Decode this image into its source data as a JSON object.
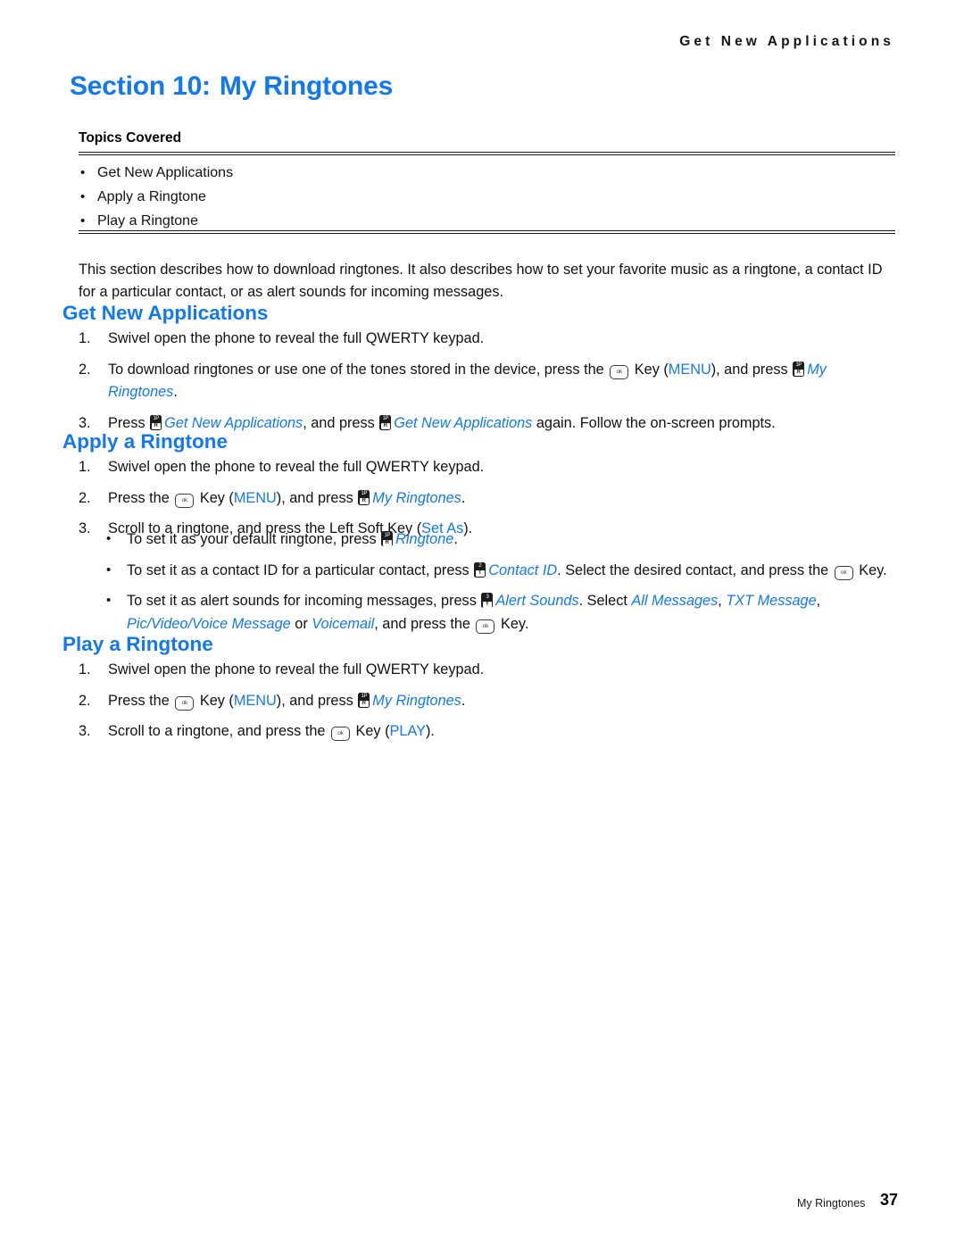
{
  "header": {
    "running_head": "Get New Applications"
  },
  "section": {
    "number_label": "Section 10:",
    "title": "My Ringtones"
  },
  "topics": {
    "label": "Topics Covered",
    "items": [
      "Get New Applications",
      "Apply a Ringtone",
      "Play a Ringtone"
    ]
  },
  "intro": "This section describes how to download ringtones. It also describes how to set your favorite music as a ringtone, a contact ID for a particular contact, or as alert sounds for incoming messages.",
  "get_new_applications": {
    "heading": "Get New Applications",
    "steps": [
      {
        "marker": "1.",
        "parts": [
          {
            "type": "text",
            "value": "Swivel open the phone to reveal the full QWERTY keypad."
          }
        ]
      },
      {
        "marker": "2.",
        "parts": [
          {
            "type": "text",
            "value": "To download ringtones or use one of the tones stored in the device, press the "
          },
          {
            "type": "ok-key",
            "value": "ok"
          },
          {
            "type": "text",
            "value": " Key ("
          },
          {
            "type": "blue",
            "value": "MENU"
          },
          {
            "type": "text",
            "value": "), and press "
          },
          {
            "type": "kb-key",
            "top": "1P",
            "bottom": "R"
          },
          {
            "type": "blue-it",
            "value": "My Ringtones"
          },
          {
            "type": "text",
            "value": "."
          }
        ]
      },
      {
        "marker": "3.",
        "parts": [
          {
            "type": "text",
            "value": "Press "
          },
          {
            "type": "kb-key",
            "top": "1P",
            "bottom": "R"
          },
          {
            "type": "blue-it",
            "value": "Get New Applications"
          },
          {
            "type": "text",
            "value": ", and press "
          },
          {
            "type": "kb-key",
            "top": "1P",
            "bottom": "R"
          },
          {
            "type": "blue-it",
            "value": "Get New Applications"
          },
          {
            "type": "text",
            "value": " again. Follow the on-screen prompts."
          }
        ]
      }
    ]
  },
  "apply_a_ringtone": {
    "heading": "Apply a Ringtone",
    "steps": [
      {
        "marker": "1.",
        "parts": [
          {
            "type": "text",
            "value": "Swivel open the phone to reveal the full QWERTY keypad."
          }
        ]
      },
      {
        "marker": "2.",
        "parts": [
          {
            "type": "text",
            "value": "Press the "
          },
          {
            "type": "ok-key",
            "value": "ok"
          },
          {
            "type": "text",
            "value": " Key ("
          },
          {
            "type": "blue",
            "value": "MENU"
          },
          {
            "type": "text",
            "value": "), and press "
          },
          {
            "type": "kb-key",
            "top": "1P",
            "bottom": "R"
          },
          {
            "type": "blue-it",
            "value": "My Ringtones"
          },
          {
            "type": "text",
            "value": "."
          }
        ]
      },
      {
        "marker": "3.",
        "parts": [
          {
            "type": "text",
            "value": "Scroll to a ringtone, and press the Left Soft Key ("
          },
          {
            "type": "blue",
            "value": "Set As"
          },
          {
            "type": "text",
            "value": ")."
          }
        ]
      }
    ],
    "sub_bullets": [
      {
        "parts": [
          {
            "type": "text",
            "value": "To set it as your default ringtone, press "
          },
          {
            "type": "kb-key",
            "top": "1P",
            "bottom": "R"
          },
          {
            "type": "blue-it",
            "value": "Ringtone"
          },
          {
            "type": "text",
            "value": "."
          }
        ]
      },
      {
        "parts": [
          {
            "type": "text",
            "value": "To set it as a contact ID for a particular contact, press "
          },
          {
            "type": "kb-key",
            "top": "2",
            "bottom": "T"
          },
          {
            "type": "blue-it",
            "value": "Contact ID"
          },
          {
            "type": "text",
            "value": ". Select the desired contact, and press the "
          },
          {
            "type": "ok-key",
            "value": "ok"
          },
          {
            "type": "text",
            "value": " Key."
          }
        ]
      },
      {
        "parts": [
          {
            "type": "text",
            "value": "To set it as alert sounds for incoming messages, press "
          },
          {
            "type": "kb-key",
            "top": "3",
            "bottom": "Y"
          },
          {
            "type": "blue-it",
            "value": "Alert Sounds"
          },
          {
            "type": "text",
            "value": ". Select "
          },
          {
            "type": "blue-it",
            "value": "All Messages"
          },
          {
            "type": "text",
            "value": ", "
          },
          {
            "type": "blue-it",
            "value": "TXT Message"
          },
          {
            "type": "text",
            "value": ", "
          },
          {
            "type": "blue-it",
            "value": "Pic/Video/Voice Message"
          },
          {
            "type": "text",
            "value": " or "
          },
          {
            "type": "blue-it",
            "value": "Voicemail"
          },
          {
            "type": "text",
            "value": ", and press the "
          },
          {
            "type": "ok-key",
            "value": "ok"
          },
          {
            "type": "text",
            "value": " Key."
          }
        ]
      }
    ]
  },
  "play_a_ringtone": {
    "heading": "Play a Ringtone",
    "steps": [
      {
        "marker": "1.",
        "parts": [
          {
            "type": "text",
            "value": "Swivel open the phone to reveal the full QWERTY keypad."
          }
        ]
      },
      {
        "marker": "2.",
        "parts": [
          {
            "type": "text",
            "value": "Press the "
          },
          {
            "type": "ok-key",
            "value": "ok"
          },
          {
            "type": "text",
            "value": " Key ("
          },
          {
            "type": "blue",
            "value": "MENU"
          },
          {
            "type": "text",
            "value": "), and press "
          },
          {
            "type": "kb-key",
            "top": "1P",
            "bottom": "R"
          },
          {
            "type": "blue-it",
            "value": "My Ringtones"
          },
          {
            "type": "text",
            "value": "."
          }
        ]
      },
      {
        "marker": "3.",
        "parts": [
          {
            "type": "text",
            "value": "Scroll to a ringtone, and press the "
          },
          {
            "type": "ok-key",
            "value": "ok"
          },
          {
            "type": "text",
            "value": " Key ("
          },
          {
            "type": "blue",
            "value": "PLAY"
          },
          {
            "type": "text",
            "value": ")."
          }
        ]
      }
    ]
  },
  "footer": {
    "label": "My Ringtones",
    "page_number": "37"
  },
  "colors": {
    "accent_blue": "#1278f0",
    "body_text": "#111111",
    "rule": "#1a1a1a"
  }
}
